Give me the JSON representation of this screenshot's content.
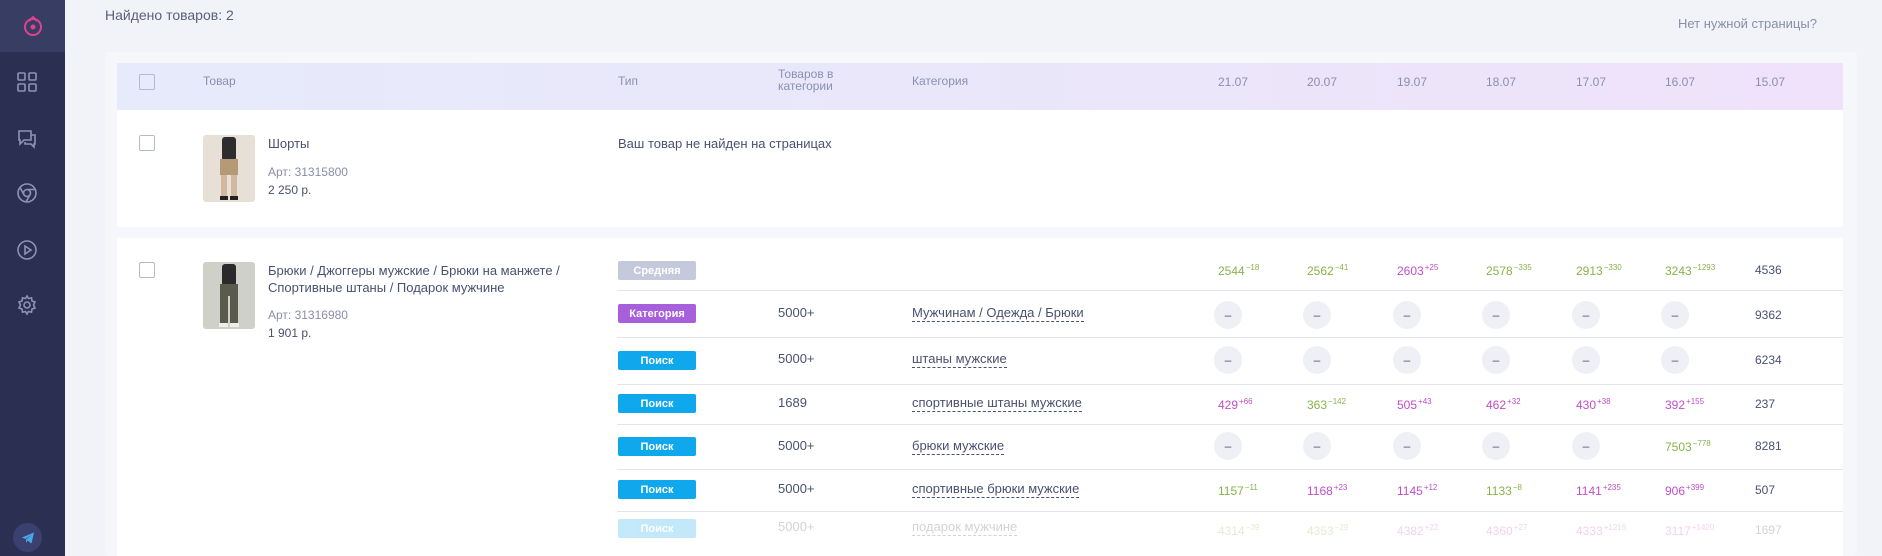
{
  "header": {
    "found_label": "Найдено товаров: 2",
    "no_page_link": "Нет нужной страницы?"
  },
  "table": {
    "columns": {
      "product": "Товар",
      "type": "Тип",
      "count": "Товаров в категории",
      "category": "Категория"
    },
    "dates": [
      "21.07",
      "20.07",
      "19.07",
      "18.07",
      "17.07",
      "16.07",
      "15.07"
    ]
  },
  "products": [
    {
      "name": "Шорты",
      "article": "Арт: 31315800",
      "price": "2 250 р.",
      "status": "Ваш товар не найден на страницах"
    },
    {
      "name": "Брюки / Джоггеры мужские / Брюки на манжете / Спортивные штаны / Подарок мужчине",
      "article": "Арт: 31316980",
      "price": "1 901 р."
    }
  ],
  "rows": [
    {
      "badge": "Средняя",
      "count": "",
      "category": "",
      "values": [
        {
          "v": "2544",
          "d": "−18",
          "c": "green"
        },
        {
          "v": "2562",
          "d": "−41",
          "c": "green"
        },
        {
          "v": "2603",
          "d": "+25",
          "c": "pink"
        },
        {
          "v": "2578",
          "d": "−335",
          "c": "green"
        },
        {
          "v": "2913",
          "d": "−330",
          "c": "green"
        },
        {
          "v": "3243",
          "d": "−1293",
          "c": "green"
        },
        {
          "v": "4536",
          "d": "",
          "c": "plain"
        }
      ]
    },
    {
      "badge": "Категория",
      "count": "5000+",
      "category": "Мужчинам / Одежда / Брюки",
      "values": [
        {
          "v": "–",
          "d": "",
          "c": "dash"
        },
        {
          "v": "–",
          "d": "",
          "c": "dash"
        },
        {
          "v": "–",
          "d": "",
          "c": "dash"
        },
        {
          "v": "–",
          "d": "",
          "c": "dash"
        },
        {
          "v": "–",
          "d": "",
          "c": "dash"
        },
        {
          "v": "–",
          "d": "",
          "c": "dash"
        },
        {
          "v": "9362",
          "d": "",
          "c": "plain"
        }
      ]
    },
    {
      "badge": "Поиск",
      "count": "5000+",
      "category": "штаны мужские",
      "values": [
        {
          "v": "–",
          "d": "",
          "c": "dash"
        },
        {
          "v": "–",
          "d": "",
          "c": "dash"
        },
        {
          "v": "–",
          "d": "",
          "c": "dash"
        },
        {
          "v": "–",
          "d": "",
          "c": "dash"
        },
        {
          "v": "–",
          "d": "",
          "c": "dash"
        },
        {
          "v": "–",
          "d": "",
          "c": "dash"
        },
        {
          "v": "6234",
          "d": "",
          "c": "plain"
        }
      ]
    },
    {
      "badge": "Поиск",
      "count": "1689",
      "category": "спортивные штаны мужские",
      "values": [
        {
          "v": "429",
          "d": "+66",
          "c": "pink"
        },
        {
          "v": "363",
          "d": "−142",
          "c": "green"
        },
        {
          "v": "505",
          "d": "+43",
          "c": "pink"
        },
        {
          "v": "462",
          "d": "+32",
          "c": "pink"
        },
        {
          "v": "430",
          "d": "+38",
          "c": "pink"
        },
        {
          "v": "392",
          "d": "+155",
          "c": "pink"
        },
        {
          "v": "237",
          "d": "",
          "c": "plain"
        }
      ]
    },
    {
      "badge": "Поиск",
      "count": "5000+",
      "category": "брюки мужские",
      "values": [
        {
          "v": "–",
          "d": "",
          "c": "dash"
        },
        {
          "v": "–",
          "d": "",
          "c": "dash"
        },
        {
          "v": "–",
          "d": "",
          "c": "dash"
        },
        {
          "v": "–",
          "d": "",
          "c": "dash"
        },
        {
          "v": "–",
          "d": "",
          "c": "dash"
        },
        {
          "v": "7503",
          "d": "−778",
          "c": "green"
        },
        {
          "v": "8281",
          "d": "",
          "c": "plain"
        }
      ]
    },
    {
      "badge": "Поиск",
      "count": "5000+",
      "category": "спортивные брюки мужские",
      "values": [
        {
          "v": "1157",
          "d": "−11",
          "c": "green"
        },
        {
          "v": "1168",
          "d": "+23",
          "c": "pink"
        },
        {
          "v": "1145",
          "d": "+12",
          "c": "pink"
        },
        {
          "v": "1133",
          "d": "−8",
          "c": "green"
        },
        {
          "v": "1141",
          "d": "+235",
          "c": "pink"
        },
        {
          "v": "906",
          "d": "+399",
          "c": "pink"
        },
        {
          "v": "507",
          "d": "",
          "c": "plain"
        }
      ]
    },
    {
      "badge": "Поиск",
      "count": "5000+",
      "category": "подарок мужчине",
      "values": [
        {
          "v": "4314",
          "d": "−39",
          "c": "green"
        },
        {
          "v": "4353",
          "d": "−29",
          "c": "green"
        },
        {
          "v": "4382",
          "d": "+22",
          "c": "pink"
        },
        {
          "v": "4360",
          "d": "+27",
          "c": "pink"
        },
        {
          "v": "4333",
          "d": "+1216",
          "c": "pink"
        },
        {
          "v": "3117",
          "d": "+1420",
          "c": "pink"
        },
        {
          "v": "1697",
          "d": "",
          "c": "plain"
        }
      ]
    }
  ],
  "colors": {
    "sidebar": "#2b3052",
    "accent_pink": "#e0428f",
    "badge_category": "#a85fdc",
    "badge_search": "#0fa8ec",
    "badge_middle": "#c5c9dc",
    "value_green": "#88b34a",
    "value_pink": "#c04ec7"
  },
  "icons": [
    "logo-icon",
    "dashboard-icon",
    "chat-icon",
    "chrome-icon",
    "play-icon",
    "settings-icon",
    "telegram-icon"
  ]
}
